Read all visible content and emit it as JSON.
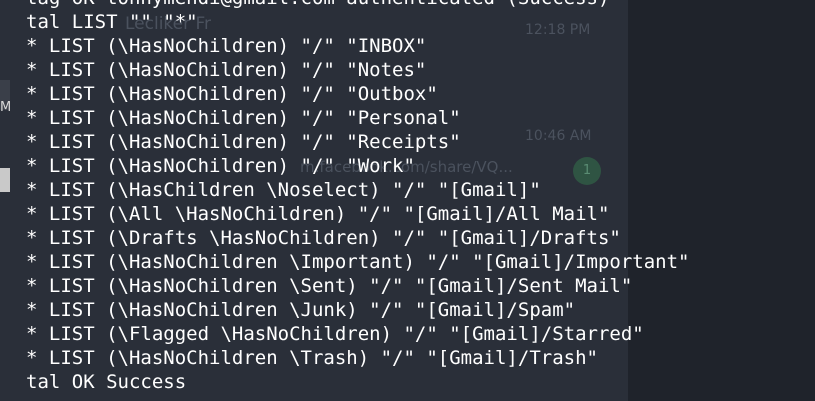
{
  "background": {
    "sidebar_letter": "M",
    "faint_texts": [
      "Lecliker Fr",
      "12:18 PM",
      "10:46 AM",
      "m.facebook.com/share/VQ..."
    ],
    "badge_count": "1"
  },
  "terminal": {
    "lines": [
      "tag OK tonnymendi@gmail.com authenticated (Success)",
      "tal LIST \"\" \"*\"",
      "* LIST (\\HasNoChildren) \"/\" \"INBOX\"",
      "* LIST (\\HasNoChildren) \"/\" \"Notes\"",
      "* LIST (\\HasNoChildren) \"/\" \"Outbox\"",
      "* LIST (\\HasNoChildren) \"/\" \"Personal\"",
      "* LIST (\\HasNoChildren) \"/\" \"Receipts\"",
      "* LIST (\\HasNoChildren) \"/\" \"Work\"",
      "* LIST (\\HasChildren \\Noselect) \"/\" \"[Gmail]\"",
      "* LIST (\\All \\HasNoChildren) \"/\" \"[Gmail]/All Mail\"",
      "* LIST (\\Drafts \\HasNoChildren) \"/\" \"[Gmail]/Drafts\"",
      "* LIST (\\HasNoChildren \\Important) \"/\" \"[Gmail]/Important\"",
      "* LIST (\\HasNoChildren \\Sent) \"/\" \"[Gmail]/Sent Mail\"",
      "* LIST (\\HasNoChildren \\Junk) \"/\" \"[Gmail]/Spam\"",
      "* LIST (\\Flagged \\HasNoChildren) \"/\" \"[Gmail]/Starred\"",
      "* LIST (\\HasNoChildren \\Trash) \"/\" \"[Gmail]/Trash\"",
      "tal OK Success"
    ]
  },
  "colors": {
    "terminal_bg": "#22262f",
    "text": "#ffffff"
  }
}
